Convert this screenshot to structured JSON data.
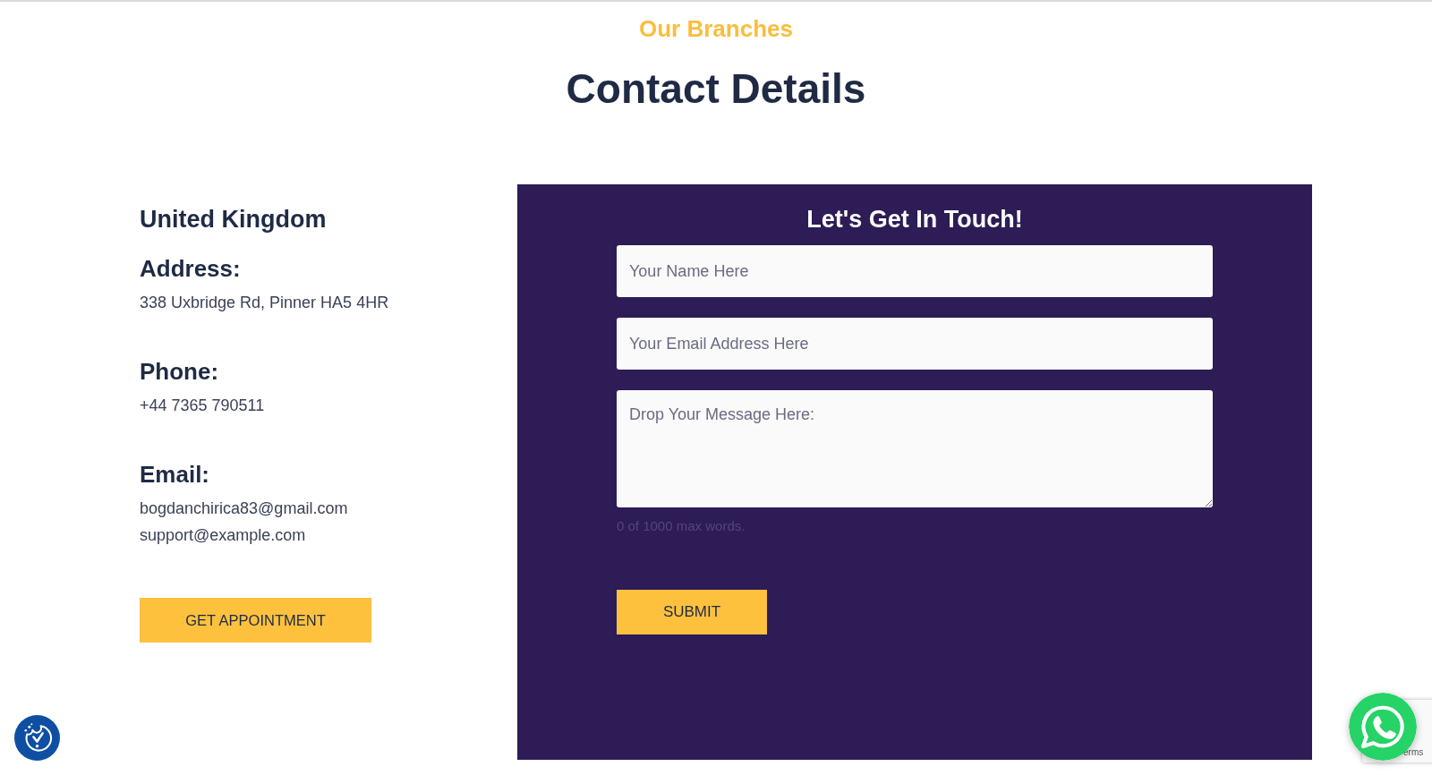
{
  "section": {
    "eyebrow": "Our Branches",
    "title": "Contact Details"
  },
  "branch": {
    "country": "United Kingdom",
    "blocks": [
      {
        "heading": "Address:",
        "lines": [
          "338 Uxbridge Rd, Pinner HA5 4HR"
        ]
      },
      {
        "heading": "Phone:",
        "lines": [
          "+44 7365 790511"
        ]
      },
      {
        "heading": "Email:",
        "lines": [
          "bogdanchirica83@gmail.com",
          "support@example.com"
        ]
      }
    ],
    "button": "GET APPOINTMENT"
  },
  "form": {
    "title": "Let's Get In Touch!",
    "fields": [
      {
        "kind": "input",
        "placeholder": "Your Name Here"
      },
      {
        "kind": "input",
        "placeholder": "Your Email Address Here"
      },
      {
        "kind": "textarea",
        "placeholder": "Drop Your Message Here:"
      }
    ],
    "word_count": "0 of 1000 max words.",
    "submit": "SUBMIT"
  },
  "recaptcha_badge": {
    "link": "erms"
  }
}
